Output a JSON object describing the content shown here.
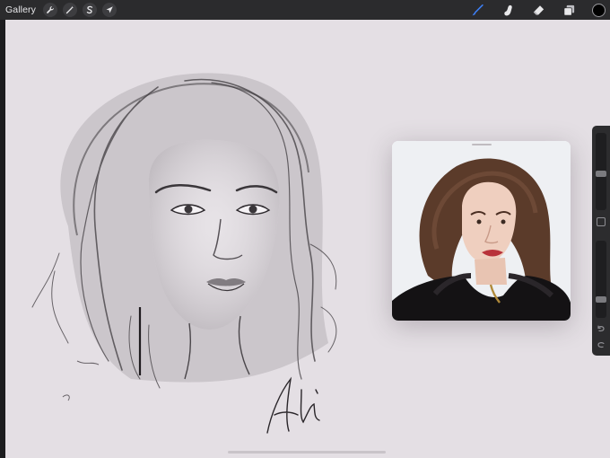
{
  "topbar": {
    "gallery_label": "Gallery",
    "left_tools": [
      {
        "name": "actions",
        "icon": "wrench-icon"
      },
      {
        "name": "adjustments",
        "icon": "magic-wand-icon"
      },
      {
        "name": "selection",
        "icon": "selection-s-icon"
      },
      {
        "name": "transform",
        "icon": "arrow-cursor-icon"
      }
    ],
    "right_tools": [
      {
        "name": "brush",
        "icon": "brush-icon",
        "active": true,
        "color": "#3d7ff5"
      },
      {
        "name": "smudge",
        "icon": "smudge-finger-icon",
        "active": false
      },
      {
        "name": "eraser",
        "icon": "eraser-icon",
        "active": false
      },
      {
        "name": "layers",
        "icon": "layers-icon",
        "active": false
      }
    ],
    "current_color": "#000000"
  },
  "canvas": {
    "background": "#e4dfe4",
    "artwork": "pencil-portrait-sketch",
    "signature": "Ani"
  },
  "reference_window": {
    "content": "reference-photo"
  },
  "side_slider": {
    "brush_size_icon": "size-slider",
    "opacity_icon": "opacity-slider",
    "modify_icon": "square-modify-icon",
    "undo_icon": "undo-icon",
    "redo_icon": "redo-icon"
  }
}
